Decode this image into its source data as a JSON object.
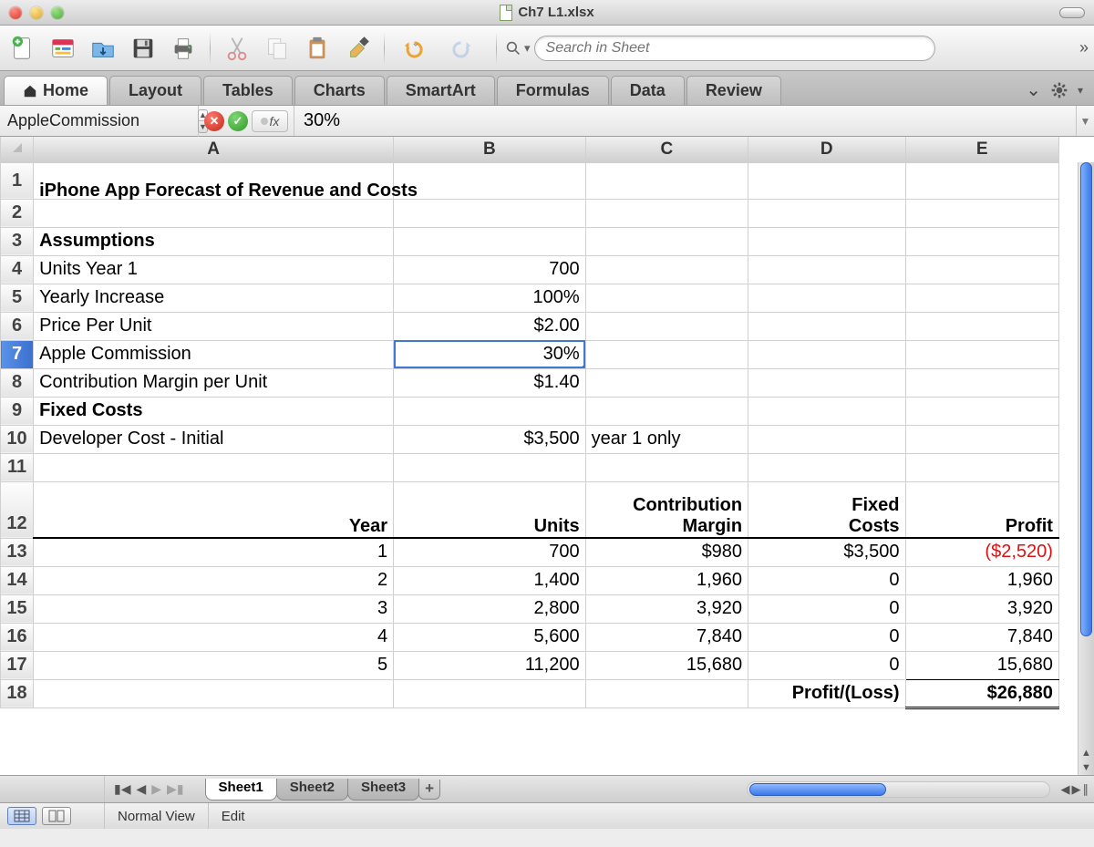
{
  "window": {
    "title": "Ch7 L1.xlsx"
  },
  "toolbar": {
    "search_placeholder": "Search in Sheet"
  },
  "ribbon": {
    "tabs": [
      "Home",
      "Layout",
      "Tables",
      "Charts",
      "SmartArt",
      "Formulas",
      "Data",
      "Review"
    ]
  },
  "formula_bar": {
    "name_box": "AppleCommission",
    "formula": "30%"
  },
  "columns": [
    "A",
    "B",
    "C",
    "D",
    "E"
  ],
  "row_numbers": [
    "1",
    "2",
    "3",
    "4",
    "5",
    "6",
    "7",
    "8",
    "9",
    "10",
    "11",
    "12",
    "13",
    "14",
    "15",
    "16",
    "17",
    "18"
  ],
  "selected_row": "7",
  "sheet": {
    "title": "iPhone App Forecast of Revenue and Costs",
    "assumptions_header": "Assumptions",
    "assumptions": {
      "units_y1_label": "Units Year 1",
      "units_y1_val": "700",
      "yearly_inc_label": "Yearly Increase",
      "yearly_inc_val": "100%",
      "price_label": "Price Per Unit",
      "price_val": "$2.00",
      "commission_label": "Apple Commission",
      "commission_val": "30%",
      "cm_label": "Contribution Margin per Unit",
      "cm_val": "$1.40"
    },
    "fixed_header": "Fixed  Costs",
    "fixed": {
      "dev_label": "Developer Cost - Initial",
      "dev_val": "$3,500",
      "dev_note": "year 1 only"
    },
    "table_headers": {
      "year": "Year",
      "units": "Units",
      "cm_top": "Contribution",
      "cm_bot": "Margin",
      "fc_top": "Fixed",
      "fc_bot": "Costs",
      "profit": "Profit"
    },
    "rows": [
      {
        "year": "1",
        "units": "700",
        "cm": "$980",
        "fc": "$3,500",
        "profit": "($2,520)",
        "neg": true
      },
      {
        "year": "2",
        "units": "1,400",
        "cm": "1,960",
        "fc": "0",
        "profit": "1,960"
      },
      {
        "year": "3",
        "units": "2,800",
        "cm": "3,920",
        "fc": "0",
        "profit": "3,920"
      },
      {
        "year": "4",
        "units": "5,600",
        "cm": "7,840",
        "fc": "0",
        "profit": "7,840"
      },
      {
        "year": "5",
        "units": "11,200",
        "cm": "15,680",
        "fc": "0",
        "profit": "15,680"
      }
    ],
    "total_label": "Profit/(Loss)",
    "total_val": "$26,880"
  },
  "sheet_tabs": [
    "Sheet1",
    "Sheet2",
    "Sheet3"
  ],
  "active_sheet_tab": 0,
  "status": {
    "view_label": "Normal View",
    "mode": "Edit"
  }
}
